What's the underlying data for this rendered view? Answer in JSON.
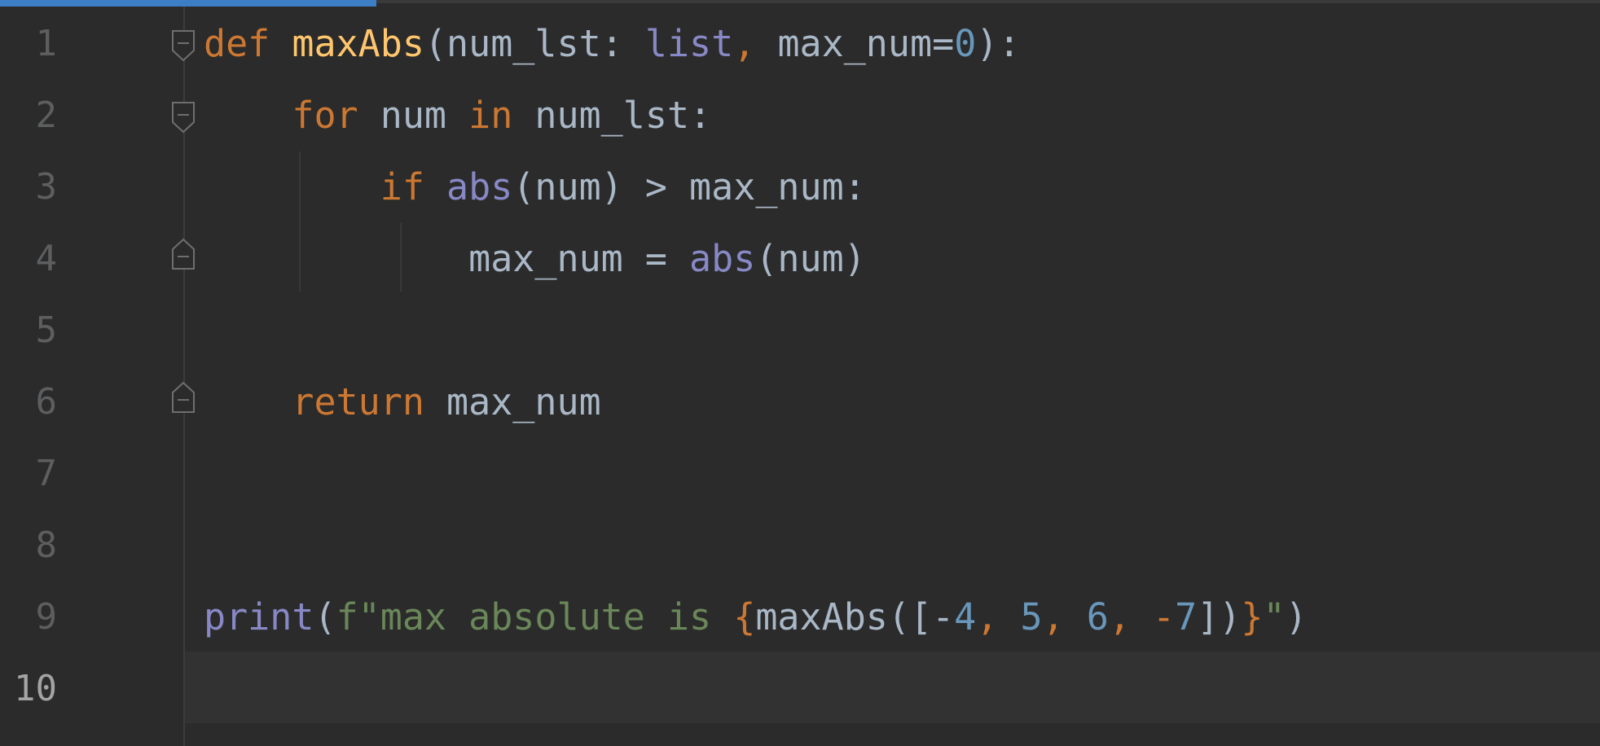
{
  "editor": {
    "colors": {
      "background": "#2b2b2b",
      "current_line": "#323232",
      "keyword": "#cc7832",
      "function_name": "#ffc66d",
      "identifier": "#a9b7c6",
      "builtin": "#8888c6",
      "number": "#6897bb",
      "string": "#6a8759",
      "line_number": "#5c5e60",
      "tab_indicator": "#3d7fc7"
    },
    "current_line": 10,
    "line_numbers": [
      "1",
      "2",
      "3",
      "4",
      "5",
      "6",
      "7",
      "8",
      "9",
      "10"
    ],
    "fold_icons": {
      "line_1": "fold-collapse-icon",
      "line_2": "fold-collapse-icon",
      "line_4": "fold-end-icon",
      "line_6": "fold-end-icon"
    },
    "lines": {
      "l1": {
        "kw_def": "def",
        "fn_name": "maxAbs",
        "open": "(",
        "param1": "num_lst",
        "colon1": ": ",
        "type": "list",
        "comma": ", ",
        "param2": "max_num",
        "eq": "=",
        "default": "0",
        "close": "):"
      },
      "l2": {
        "kw_for": "for",
        "var": "num",
        "kw_in": "in",
        "iter": "num_lst:"
      },
      "l3": {
        "kw_if": "if",
        "abs": "abs",
        "call": "(num) > max_num:"
      },
      "l4": {
        "target": "max_num = ",
        "abs": "abs",
        "call": "(num)"
      },
      "l6": {
        "kw_return": "return",
        "value": "max_num"
      },
      "l9": {
        "print": "print",
        "open": "(",
        "fstring_start": "f\"max absolute is ",
        "brace_open": "{",
        "call": "maxAbs([-",
        "n1": "4",
        "c1": ", ",
        "n2": "5",
        "c2": ", ",
        "n3": "6",
        "c3": ", -",
        "n4": "7",
        "call_close": "])",
        "brace_close": "}",
        "fstring_end": "\"",
        "close": ")"
      }
    }
  }
}
